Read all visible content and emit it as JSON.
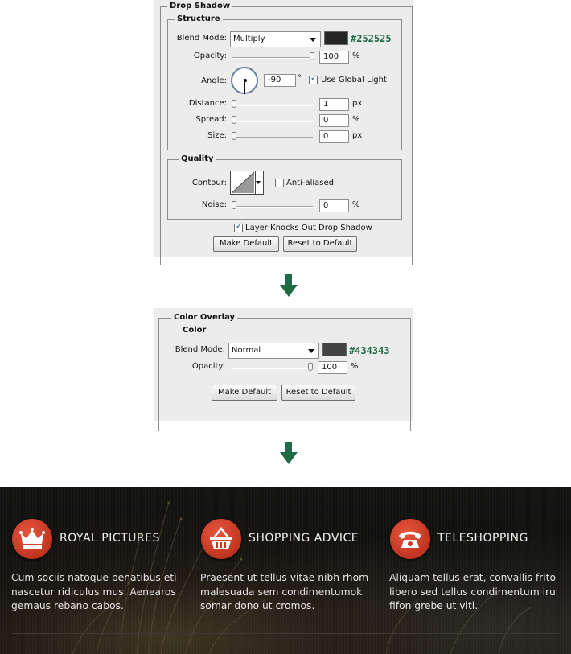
{
  "drop_shadow": {
    "title": "Drop Shadow",
    "structure": {
      "title": "Structure",
      "blend_mode_label": "Blend Mode:",
      "blend_mode_value": "Multiply",
      "color_hex": "#252525",
      "color": "#252525",
      "opacity_label": "Opacity:",
      "opacity_value": "100",
      "opacity_unit": "%",
      "opacity_fraction": 1.0,
      "angle_label": "Angle:",
      "angle_value": "-90",
      "angle_unit": "°",
      "use_global_light_label": "Use Global Light",
      "use_global_light_checked": true,
      "distance_label": "Distance:",
      "distance_value": "1",
      "distance_unit": "px",
      "spread_label": "Spread:",
      "spread_value": "0",
      "spread_unit": "%",
      "size_label": "Size:",
      "size_value": "0",
      "size_unit": "px"
    },
    "quality": {
      "title": "Quality",
      "contour_label": "Contour:",
      "anti_aliased_label": "Anti-aliased",
      "anti_aliased_checked": false,
      "noise_label": "Noise:",
      "noise_value": "0",
      "noise_unit": "%"
    },
    "layer_knocks_label": "Layer Knocks Out Drop Shadow",
    "layer_knocks_checked": true,
    "make_default_label": "Make Default",
    "reset_default_label": "Reset to Default"
  },
  "color_overlay": {
    "title": "Color Overlay",
    "color_group_title": "Color",
    "blend_mode_label": "Blend Mode:",
    "blend_mode_value": "Normal",
    "color_hex": "#434343",
    "color": "#434343",
    "opacity_label": "Opacity:",
    "opacity_value": "100",
    "opacity_unit": "%",
    "opacity_fraction": 1.0,
    "make_default_label": "Make Default",
    "reset_default_label": "Reset to Default"
  },
  "arrow_color": "#1f6b47",
  "features": [
    {
      "icon": "crown-icon",
      "title": "ROYAL PICTURES",
      "description": "Cum sociis natoque penatibus eti nascetur ridiculus mus. Aenearos gemaus rebano cabos."
    },
    {
      "icon": "basket-icon",
      "title": "SHOPPING ADVICE",
      "description": "Praesent ut tellus vitae nibh rhom malesuada sem condimentumok somar dono ut cromos."
    },
    {
      "icon": "phone-icon",
      "title": "TELESHOPPING",
      "description": "Aliquam tellus erat, convallis frito libero sed tellus condimentum iru fifon grebe ut viti."
    }
  ],
  "accent_color": "#d2432c"
}
